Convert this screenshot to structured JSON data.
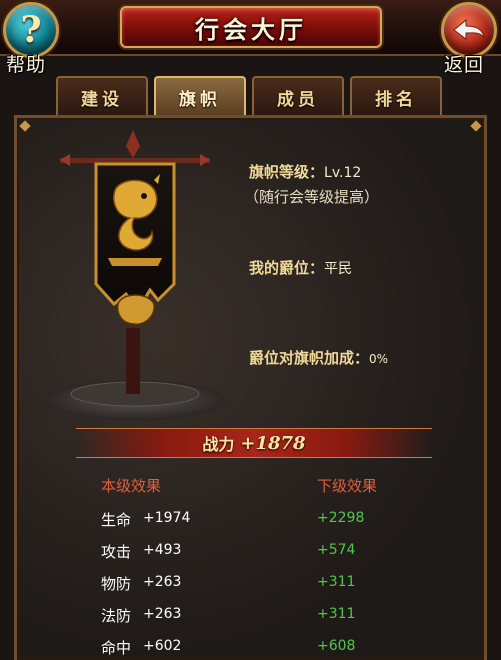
{
  "header": {
    "title": "行会大厅",
    "help_glyph": "?",
    "help_label": "帮助",
    "back_label": "返回"
  },
  "tabs": [
    {
      "label": "建设",
      "active": false
    },
    {
      "label": "旗帜",
      "active": true
    },
    {
      "label": "成员",
      "active": false
    },
    {
      "label": "排名",
      "active": false
    }
  ],
  "banner_info": {
    "level_label": "旗帜等级：",
    "level_value": "Lv.12",
    "level_note": "（随行会等级提高）",
    "rank_label": "我的爵位：",
    "rank_value": "平民",
    "bonus_label": "爵位对旗帜加成：",
    "bonus_value": "0%"
  },
  "power": {
    "label": "战力",
    "value": "+1878"
  },
  "effects": {
    "current_header": "本级效果",
    "next_header": "下级效果",
    "rows": [
      {
        "name": "生命",
        "current": "+1974",
        "next": "+2298"
      },
      {
        "name": "攻击",
        "current": "+493",
        "next": "+574"
      },
      {
        "name": "物防",
        "current": "+263",
        "next": "+311"
      },
      {
        "name": "法防",
        "current": "+263",
        "next": "+311"
      },
      {
        "name": "命中",
        "current": "+602",
        "next": "+608"
      }
    ]
  },
  "colors": {
    "accent_gold": "#f0d898",
    "header_red": "#e0603a",
    "next_green": "#4ec84a"
  },
  "icons": {
    "help": "question-mark-icon",
    "back": "back-arrow-icon",
    "banner": "guild-banner-dragon-icon"
  }
}
